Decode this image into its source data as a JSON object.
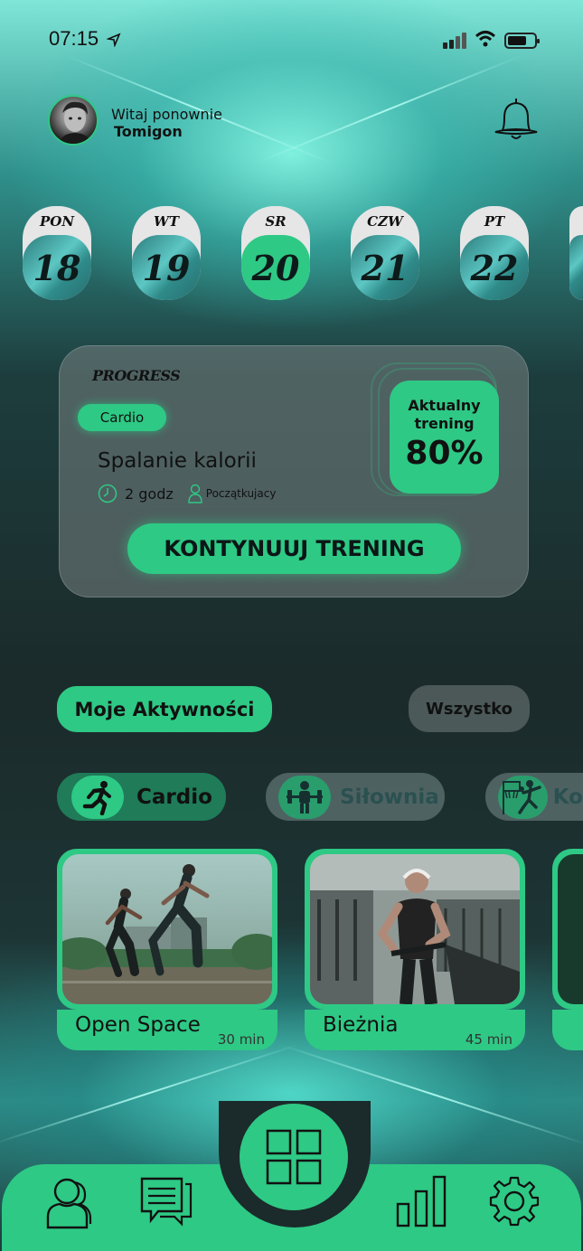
{
  "status_bar": {
    "time": "07:15"
  },
  "header": {
    "greeting": "Witaj ponownie",
    "username": "Tomigon"
  },
  "days": [
    {
      "name": "PON",
      "num": "18",
      "active": false
    },
    {
      "name": "WT",
      "num": "19",
      "active": false
    },
    {
      "name": "SR",
      "num": "20",
      "active": true
    },
    {
      "name": "CZW",
      "num": "21",
      "active": false
    },
    {
      "name": "PT",
      "num": "22",
      "active": false
    }
  ],
  "progress": {
    "title": "PROGRESS",
    "category": "Cardio",
    "workout": "Spalanie kalorii",
    "duration": "2 godz",
    "level": "Początkujacy",
    "current_label": "Aktualny trening",
    "percent": "80%",
    "cta": "KONTYNUUJ TRENING"
  },
  "activities": {
    "title": "Moje Aktywności",
    "all_label": "Wszystko",
    "categories": [
      {
        "label": "Cardio",
        "icon": "running-icon",
        "active": true
      },
      {
        "label": "Siłownia",
        "icon": "weightlifting-icon",
        "active": false
      },
      {
        "label": "Ko",
        "icon": "basketball-icon",
        "active": false
      }
    ],
    "items": [
      {
        "name": "Open Space",
        "duration": "30 min"
      },
      {
        "name": "Bieżnia",
        "duration": "45 min"
      }
    ]
  },
  "nav": {
    "items": [
      "profile-icon",
      "chat-icon",
      "dashboard-icon",
      "stats-icon",
      "settings-icon"
    ]
  },
  "colors": {
    "accent": "#2ec985",
    "background": "#1b2a2a"
  }
}
